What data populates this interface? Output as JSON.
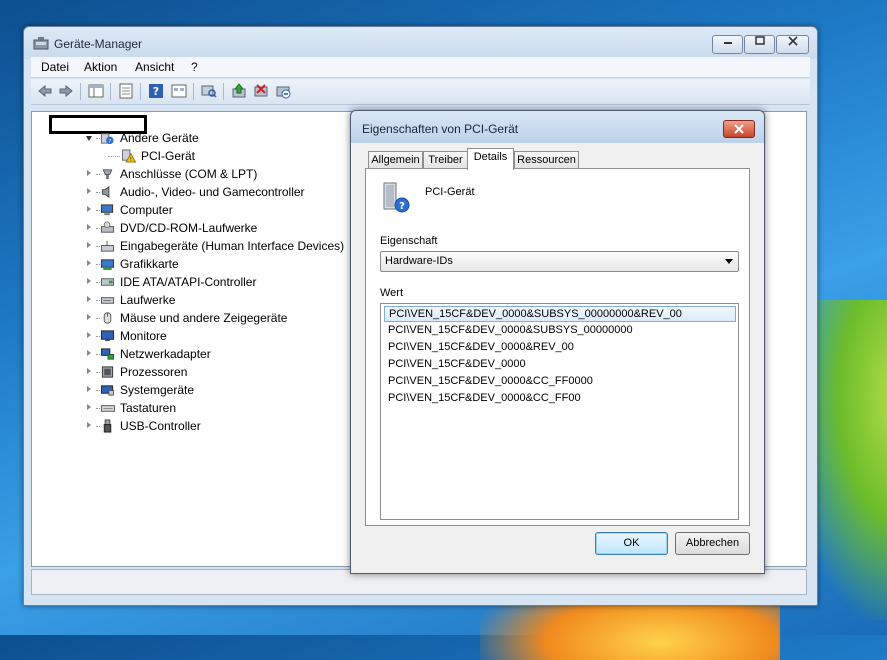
{
  "window": {
    "title": "Geräte-Manager",
    "min": "▭",
    "max": "▢",
    "close": "✕"
  },
  "menu": [
    "Datei",
    "Aktion",
    "Ansicht",
    "?"
  ],
  "toolbar": [
    "back-icon",
    "forward-icon",
    "show-hide-tree-icon",
    "properties-icon",
    "help-icon",
    "view-icon",
    "scan-hardware-icon",
    "update-driver-icon",
    "disable-icon",
    "uninstall-icon"
  ],
  "tree": {
    "root": "",
    "nodes": [
      {
        "label": "Andere Geräte",
        "icon": "unknown-device-icon",
        "expanded": true
      },
      {
        "label": "PCI-Gerät",
        "icon": "warning-device-icon",
        "child": true
      },
      {
        "label": "Anschlüsse (COM & LPT)",
        "icon": "port-icon"
      },
      {
        "label": "Audio-, Video- und Gamecontroller",
        "icon": "speaker-icon"
      },
      {
        "label": "Computer",
        "icon": "computer-icon"
      },
      {
        "label": "DVD/CD-ROM-Laufwerke",
        "icon": "dvd-drive-icon"
      },
      {
        "label": "Eingabegeräte (Human Interface Devices)",
        "icon": "hid-icon"
      },
      {
        "label": "Grafikkarte",
        "icon": "display-adapter-icon"
      },
      {
        "label": "IDE ATA/ATAPI-Controller",
        "icon": "ide-controller-icon"
      },
      {
        "label": "Laufwerke",
        "icon": "disk-drive-icon"
      },
      {
        "label": "Mäuse und andere Zeigegeräte",
        "icon": "mouse-icon"
      },
      {
        "label": "Monitore",
        "icon": "monitor-icon"
      },
      {
        "label": "Netzwerkadapter",
        "icon": "network-adapter-icon"
      },
      {
        "label": "Prozessoren",
        "icon": "processor-icon"
      },
      {
        "label": "Systemgeräte",
        "icon": "system-device-icon"
      },
      {
        "label": "Tastaturen",
        "icon": "keyboard-icon"
      },
      {
        "label": "USB-Controller",
        "icon": "usb-icon"
      }
    ]
  },
  "dialog": {
    "title": "Eigenschaften von PCI-Gerät",
    "close": "✕",
    "tabs": [
      "Allgemein",
      "Treiber",
      "Details",
      "Ressourcen"
    ],
    "active_tab": "Details",
    "device_name": "PCI-Gerät",
    "property_label": "Eigenschaft",
    "property_value": "Hardware-IDs",
    "value_label": "Wert",
    "values": [
      "PCI\\VEN_15CF&DEV_0000&SUBSYS_00000000&REV_00",
      "PCI\\VEN_15CF&DEV_0000&SUBSYS_00000000",
      "PCI\\VEN_15CF&DEV_0000&REV_00",
      "PCI\\VEN_15CF&DEV_0000",
      "PCI\\VEN_15CF&DEV_0000&CC_FF0000",
      "PCI\\VEN_15CF&DEV_0000&CC_FF00"
    ],
    "selected_value_index": 0,
    "ok": "OK",
    "cancel": "Abbrechen"
  }
}
